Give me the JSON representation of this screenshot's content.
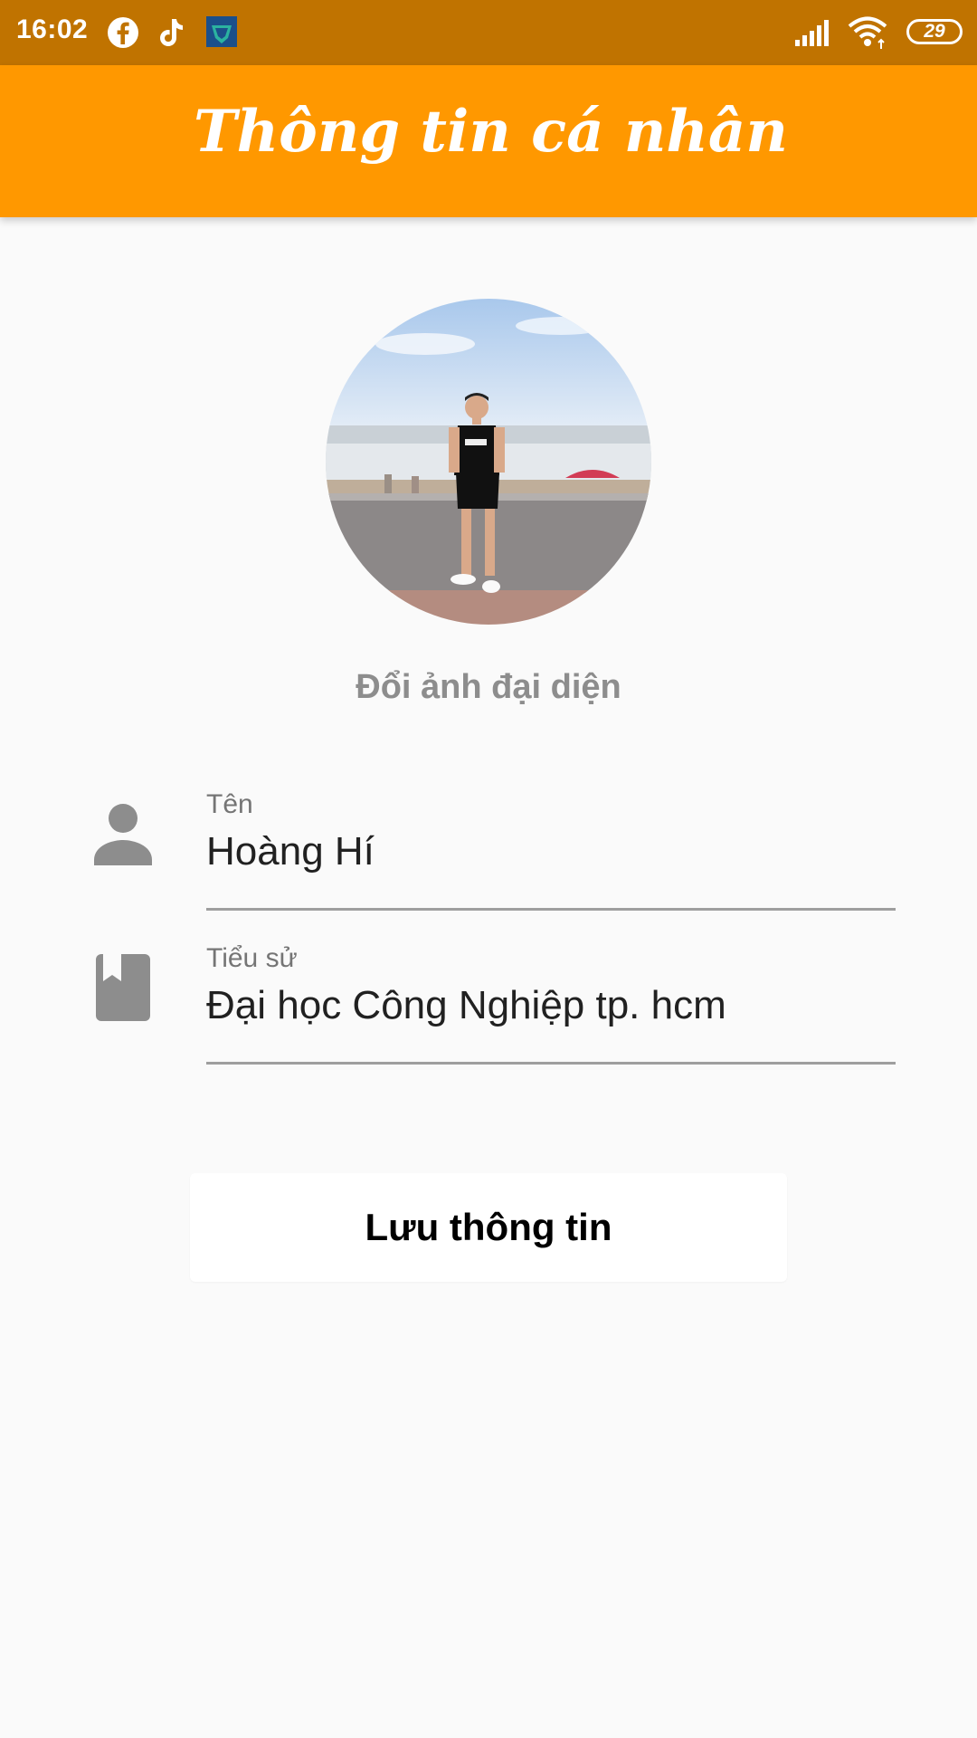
{
  "status_bar": {
    "time": "16:02",
    "battery": "29",
    "icons": [
      "facebook-icon",
      "tiktok-icon",
      "app-notification-icon",
      "signal-icon",
      "wifi-icon",
      "battery-icon"
    ]
  },
  "app_bar": {
    "title": "Thông tin cá nhân",
    "color": "#ff9800"
  },
  "profile": {
    "change_avatar_label": "Đổi ảnh đại diện",
    "fields": [
      {
        "label": "Tên",
        "value": "Hoàng Hí",
        "icon": "person-icon"
      },
      {
        "label": "Tiểu sử",
        "value": "Đại học Công Nghiệp tp. hcm",
        "icon": "book-icon"
      }
    ],
    "save_label": "Lưu thông tin"
  }
}
